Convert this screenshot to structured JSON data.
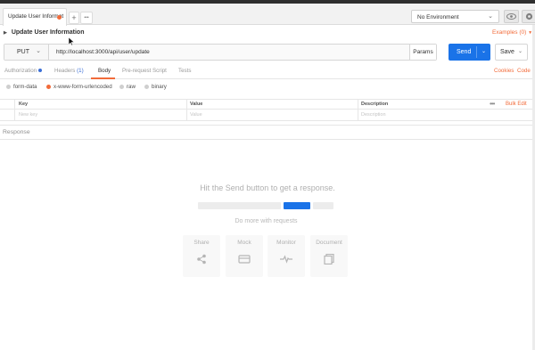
{
  "tabs": {
    "items": [
      {
        "label": "Update User Informat",
        "unsaved": true
      }
    ],
    "add_label": "+",
    "more_label": "•••"
  },
  "environment": {
    "selected": "No Environment"
  },
  "request": {
    "name": "Update User Information",
    "examples_label": "Examples (0)",
    "method": "PUT",
    "url": "http://localhost:3000/api/user/update",
    "params_label": "Params",
    "send_label": "Send",
    "save_label": "Save"
  },
  "subtabs": {
    "authorization": "Authorization",
    "headers": "Headers",
    "headers_count": "(1)",
    "body": "Body",
    "prerequest": "Pre-request Script",
    "tests": "Tests",
    "active": "Body"
  },
  "links": {
    "cookies": "Cookies",
    "code": "Code"
  },
  "body_modes": {
    "options": [
      "form-data",
      "x-www-form-urlencoded",
      "raw",
      "binary"
    ],
    "selected": "x-www-form-urlencoded"
  },
  "kv_table": {
    "headers": {
      "key": "Key",
      "value": "Value",
      "description": "Description"
    },
    "placeholders": {
      "key": "New key",
      "value": "Value",
      "description": "Description"
    },
    "more_label": "•••",
    "bulk_edit_label": "Bulk Edit"
  },
  "response": {
    "label": "Response",
    "empty_message": "Hit the Send button to get a response.",
    "do_more_label": "Do more with requests",
    "actions": [
      {
        "label": "Share",
        "icon": "share-icon"
      },
      {
        "label": "Mock",
        "icon": "mock-icon"
      },
      {
        "label": "Monitor",
        "icon": "monitor-icon"
      },
      {
        "label": "Document",
        "icon": "document-icon"
      }
    ]
  },
  "colors": {
    "accent": "#f26b3a",
    "send": "#1a73e8",
    "link_blue": "#3b6fd6"
  }
}
